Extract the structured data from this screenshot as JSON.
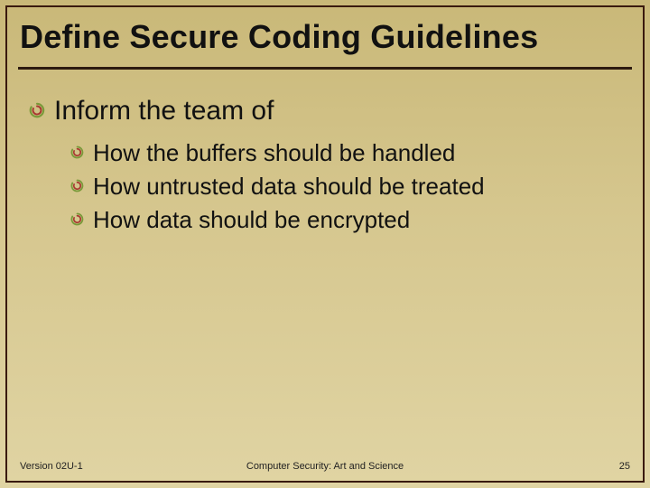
{
  "title": "Define Secure Coding Guidelines",
  "level1": {
    "text": "Inform the team of"
  },
  "level2": [
    {
      "text": "How the buffers should be handled"
    },
    {
      "text": "How untrusted data should be treated"
    },
    {
      "text": "How data should be encrypted"
    }
  ],
  "footer": {
    "version": "Version 02U-1",
    "center": "Computer Security: Art and Science",
    "page": "25"
  },
  "colors": {
    "bullet_outer": "#7a9a3a",
    "bullet_inner": "#a83830",
    "frame": "#3a1a0e"
  }
}
